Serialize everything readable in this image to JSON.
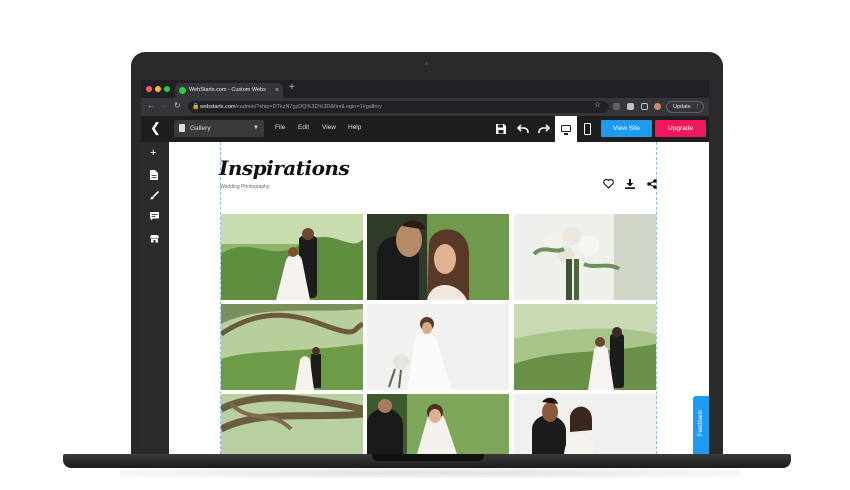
{
  "browser": {
    "tab_title": "WebStarts.com - Custom Webs",
    "tab_close": "×",
    "new_tab": "+",
    "url_domain": "webstarts.com",
    "url_path": "/cadmin/?ship=DTkzN7gzDQ%3D%3D&firstLogin=1#gallery",
    "update_label": "Update"
  },
  "toolbar": {
    "page_select_value": "Gallery",
    "menu": [
      "File",
      "Edit",
      "View",
      "Help"
    ],
    "view_site_label": "View Site",
    "upgrade_label": "Upgrade"
  },
  "site": {
    "title": "Inspirations",
    "subtitle": "Wedding Photography"
  },
  "feedback": {
    "label": "Feedback"
  },
  "colors": {
    "accent_blue": "#1e9bf0",
    "upgrade_pink": "#f0185a",
    "toolbar_bg": "#1e1e1e",
    "rail_bg": "#2b2b2b"
  },
  "icons": {
    "rail": [
      "plus-icon",
      "page-icon",
      "brush-icon",
      "comment-icon",
      "store-icon"
    ],
    "toolbar": [
      "save-icon",
      "undo-icon",
      "redo-icon",
      "desktop-icon",
      "mobile-icon"
    ],
    "actions": [
      "heart-icon",
      "download-icon",
      "share-icon"
    ]
  }
}
